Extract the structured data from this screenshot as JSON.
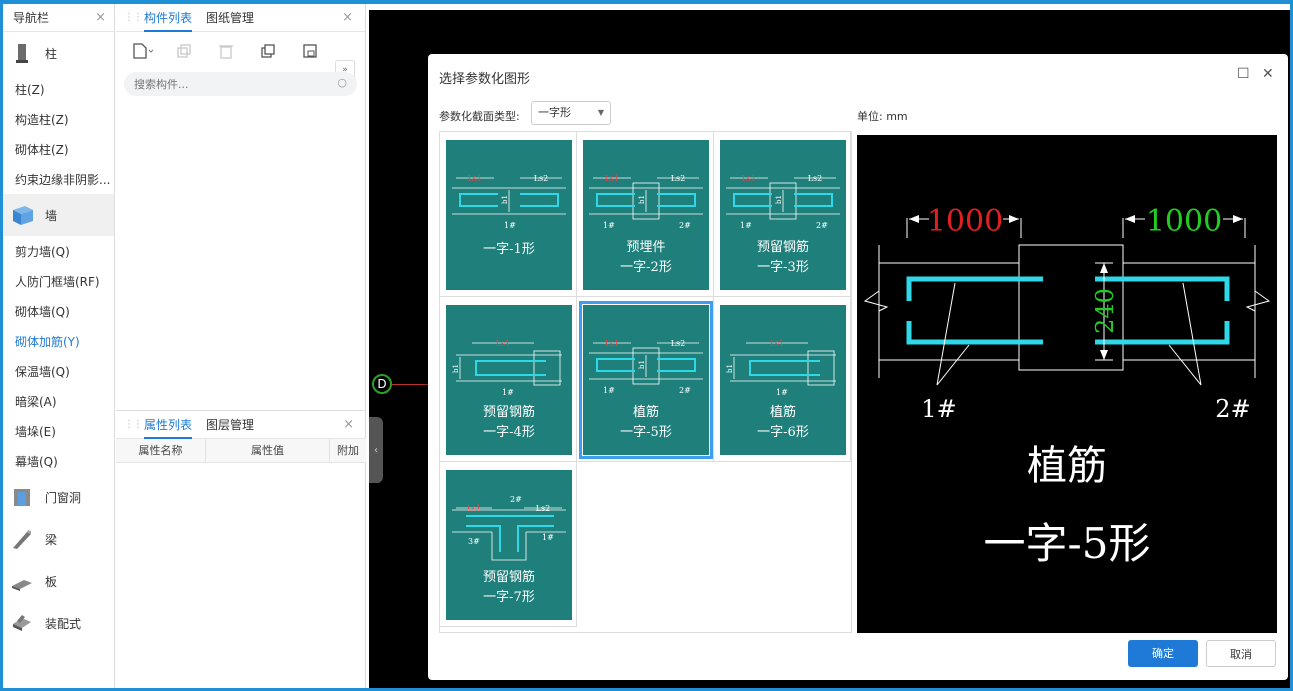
{
  "nav": {
    "header": "导航栏",
    "close": "×",
    "cat_column": "柱",
    "cat_wall": "墙",
    "cat_door": "门窗洞",
    "cat_beam": "梁",
    "cat_slab": "板",
    "cat_prefab": "装配式",
    "items_column": [
      "柱(Z)",
      "构造柱(Z)",
      "砌体柱(Z)",
      "约束边缘非阴影..."
    ],
    "items_wall": [
      "剪力墙(Q)",
      "人防门框墙(RF)",
      "砌体墙(Q)",
      "砌体加筋(Y)",
      "保温墙(Q)",
      "暗梁(A)",
      "墙垛(E)",
      "幕墙(Q)"
    ]
  },
  "comp": {
    "tab_list": "构件列表",
    "tab_drawing": "图纸管理",
    "close": "×",
    "search_placeholder": "搜索构件...",
    "more": "»"
  },
  "prop": {
    "tab_attr": "属性列表",
    "tab_layer": "图层管理",
    "close": "×",
    "col_name": "属性名称",
    "col_value": "属性值",
    "col_extra": "附加"
  },
  "canvas": {
    "axis_label": "D"
  },
  "dialog": {
    "title": "选择参数化图形",
    "maximize": "☐",
    "close": "✕",
    "type_label": "参数化截面类型:",
    "type_value": "一字形",
    "unit_label": "单位:  mm",
    "ok": "确定",
    "cancel": "取消",
    "shapes": [
      {
        "line1": "一字-1形",
        "line2": ""
      },
      {
        "line1": "预埋件",
        "line2": "一字-2形"
      },
      {
        "line1": "预留钢筋",
        "line2": "一字-3形"
      },
      {
        "line1": "预留钢筋",
        "line2": "一字-4形"
      },
      {
        "line1": "植筋",
        "line2": "一字-5形"
      },
      {
        "line1": "植筋",
        "line2": "一字-6形"
      },
      {
        "line1": "预留钢筋",
        "line2": "一字-7形"
      }
    ],
    "selected_index": 4,
    "preview": {
      "dim_left": "1000",
      "dim_right": "1000",
      "dim_height": "240",
      "bar_left": "1#",
      "bar_right": "2#",
      "name_line1": "植筋",
      "name_line2": "一字-5形",
      "dim_left_color": "#e02020",
      "dim_right_color": "#22cc22",
      "dim_height_color": "#22cc22",
      "rebar_color": "#2ed8e8"
    },
    "thumb_labels": {
      "ls1": "Ls1",
      "ls2": "Ls2",
      "b1": "b1",
      "bar1": "1#",
      "bar2": "2#",
      "bar3": "3#"
    }
  },
  "colors": {
    "accent": "#1e7ad6",
    "thumb_bg": "#1f7f7a",
    "frame": "#1f8fd6"
  }
}
